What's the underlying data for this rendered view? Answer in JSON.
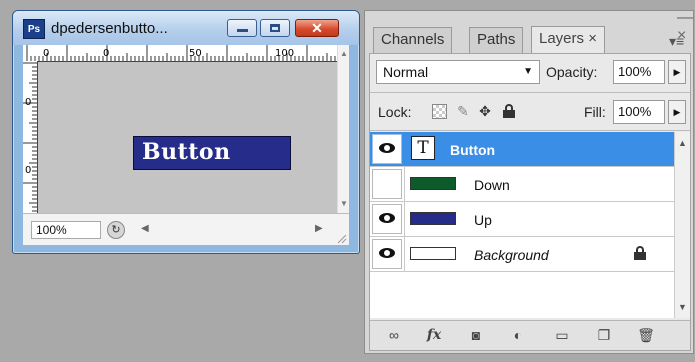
{
  "document": {
    "title": "dpedersenbutto...",
    "app_icon_text": "Ps",
    "ruler_top_labels": [
      "0",
      "0",
      "50",
      "100"
    ],
    "ruler_left_labels": [
      "0",
      "0"
    ],
    "canvas_button_text": "Button",
    "zoom": "100%",
    "close_glyph": "✕"
  },
  "panel": {
    "tabs": [
      {
        "label": "Channels"
      },
      {
        "label": "Paths"
      },
      {
        "label": "Layers ×"
      }
    ],
    "collapse_glyph": "—  ×",
    "blend_mode": "Normal",
    "opacity_label": "Opacity:",
    "opacity_value": "100%",
    "lock_label": "Lock:",
    "fill_label": "Fill:",
    "fill_value": "100%",
    "layers": [
      {
        "name": "Button",
        "visible": true,
        "selected": true,
        "thumb": "text",
        "italic": false,
        "locked": false
      },
      {
        "name": "Down",
        "visible": false,
        "selected": false,
        "thumb": "color",
        "thumb_color": "#0d5a2a",
        "italic": false,
        "locked": false
      },
      {
        "name": "Up",
        "visible": true,
        "selected": false,
        "thumb": "color",
        "thumb_color": "#262c89",
        "italic": false,
        "locked": false
      },
      {
        "name": "Background",
        "visible": true,
        "selected": false,
        "thumb": "color",
        "thumb_color": "#ffffff",
        "italic": true,
        "locked": true
      }
    ],
    "bottom_icons": [
      "link-icon",
      "fx-icon",
      "mask-icon",
      "adjustment-icon",
      "folder-icon",
      "new-layer-icon",
      "trash-icon"
    ],
    "fx_text": "fx"
  },
  "colors": {
    "selected_row": "#3a8ee6",
    "button_fill": "#262c89",
    "down_fill": "#0d5a2a"
  }
}
